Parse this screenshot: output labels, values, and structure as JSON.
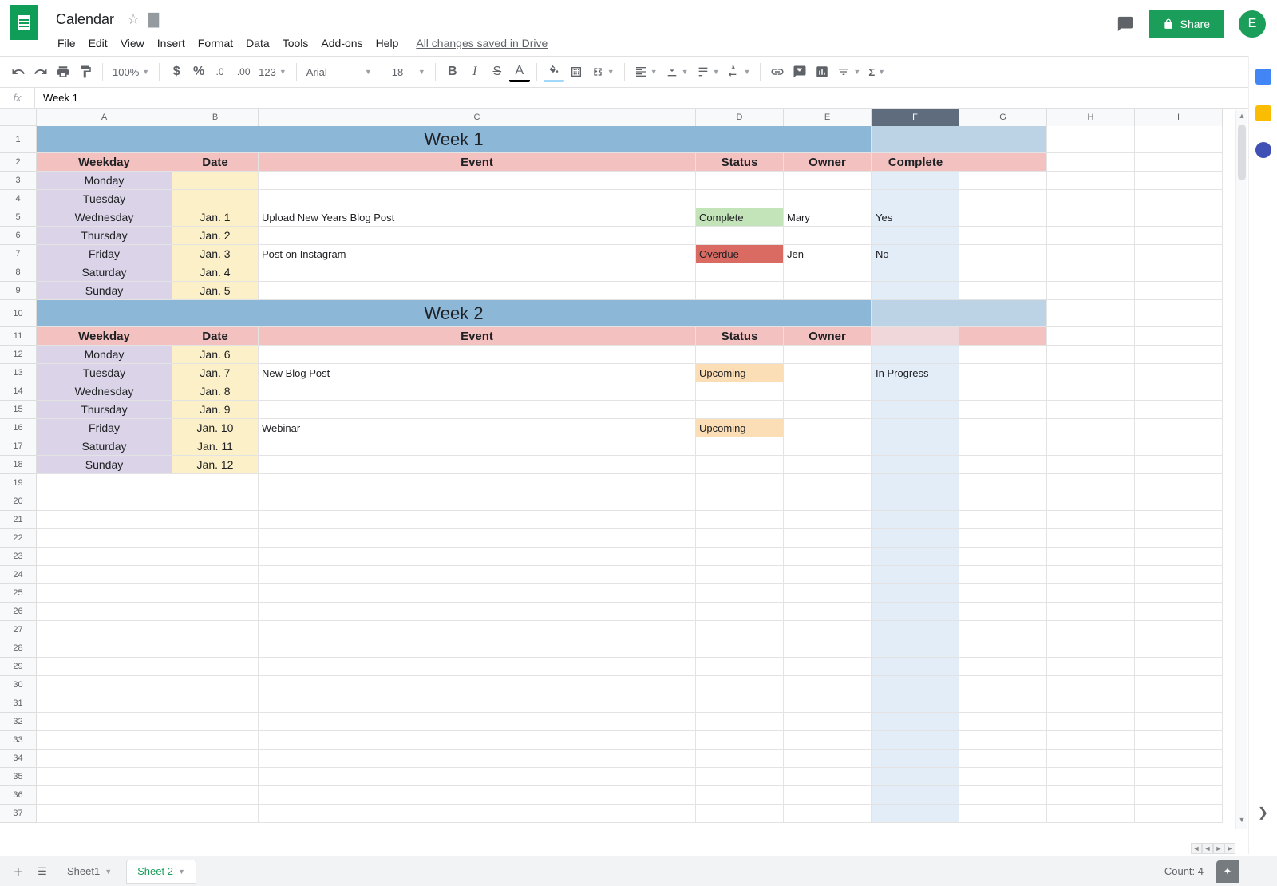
{
  "doc": {
    "title": "Calendar",
    "save_status": "All changes saved in Drive"
  },
  "menu": {
    "file": "File",
    "edit": "Edit",
    "view": "View",
    "insert": "Insert",
    "format": "Format",
    "data": "Data",
    "tools": "Tools",
    "addons": "Add-ons",
    "help": "Help"
  },
  "header": {
    "share": "Share",
    "avatar_letter": "E"
  },
  "toolbar": {
    "zoom": "100%",
    "format_123": "123",
    "font": "Arial",
    "font_size": "18"
  },
  "formula_bar": {
    "fx": "fx",
    "value": "Week 1"
  },
  "columns": [
    "A",
    "B",
    "C",
    "D",
    "E",
    "F",
    "G",
    "H",
    "I"
  ],
  "selected_col": "F",
  "row_count": 37,
  "weeks": [
    {
      "title": "Week 1",
      "headers": {
        "weekday": "Weekday",
        "date": "Date",
        "event": "Event",
        "status": "Status",
        "owner": "Owner",
        "complete": "Complete"
      },
      "rows": [
        {
          "weekday": "Monday",
          "date": "",
          "event": "",
          "status": "",
          "owner": "",
          "complete": ""
        },
        {
          "weekday": "Tuesday",
          "date": "",
          "event": "",
          "status": "",
          "owner": "",
          "complete": ""
        },
        {
          "weekday": "Wednesday",
          "date": "Jan. 1",
          "event": "Upload New Years Blog Post",
          "status": "Complete",
          "status_class": "status-complete",
          "owner": "Mary",
          "complete": "Yes"
        },
        {
          "weekday": "Thursday",
          "date": "Jan. 2",
          "event": "",
          "status": "",
          "owner": "",
          "complete": ""
        },
        {
          "weekday": "Friday",
          "date": "Jan. 3",
          "event": "Post on Instagram",
          "status": "Overdue",
          "status_class": "status-overdue",
          "owner": "Jen",
          "complete": "No"
        },
        {
          "weekday": "Saturday",
          "date": "Jan. 4",
          "event": "",
          "status": "",
          "owner": "",
          "complete": ""
        },
        {
          "weekday": "Sunday",
          "date": "Jan. 5",
          "event": "",
          "status": "",
          "owner": "",
          "complete": ""
        }
      ]
    },
    {
      "title": "Week 2",
      "headers": {
        "weekday": "Weekday",
        "date": "Date",
        "event": "Event",
        "status": "Status",
        "owner": "Owner",
        "complete": ""
      },
      "rows": [
        {
          "weekday": "Monday",
          "date": "Jan. 6",
          "event": "",
          "status": "",
          "owner": "",
          "complete": ""
        },
        {
          "weekday": "Tuesday",
          "date": "Jan. 7",
          "event": "New Blog Post",
          "status": "Upcoming",
          "status_class": "status-upcoming",
          "owner": "",
          "complete": "In Progress"
        },
        {
          "weekday": "Wednesday",
          "date": "Jan. 8",
          "event": "",
          "status": "",
          "owner": "",
          "complete": ""
        },
        {
          "weekday": "Thursday",
          "date": "Jan. 9",
          "event": "",
          "status": "",
          "owner": "",
          "complete": ""
        },
        {
          "weekday": "Friday",
          "date": "Jan. 10",
          "event": "Webinar",
          "status": "Upcoming",
          "status_class": "status-upcoming",
          "owner": "",
          "complete": ""
        },
        {
          "weekday": "Saturday",
          "date": "Jan. 11",
          "event": "",
          "status": "",
          "owner": "",
          "complete": ""
        },
        {
          "weekday": "Sunday",
          "date": "Jan. 12",
          "event": "",
          "status": "",
          "owner": "",
          "complete": ""
        }
      ]
    }
  ],
  "tabs": {
    "sheet1": "Sheet1",
    "sheet2": "Sheet 2"
  },
  "status_bar": {
    "count": "Count: 4"
  }
}
